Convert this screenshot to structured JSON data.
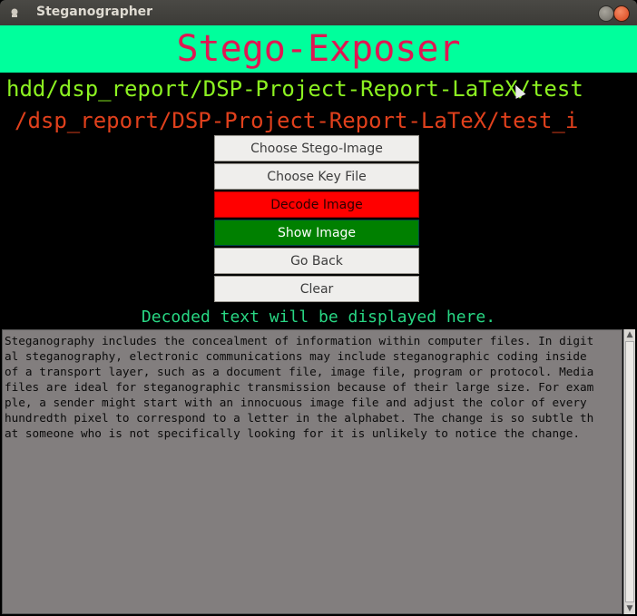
{
  "window": {
    "title": "Steganographer"
  },
  "header": {
    "title": "Stego-Exposer"
  },
  "paths": {
    "line1": "hdd/dsp_report/DSP-Project-Report-LaTeX/test",
    "line2": "/dsp_report/DSP-Project-Report-LaTeX/test_i"
  },
  "buttons": {
    "choose_stego": "Choose Stego-Image",
    "choose_key": "Choose Key File",
    "decode": "Decode Image",
    "show": "Show Image",
    "go_back": "Go Back",
    "clear": "Clear"
  },
  "status": "Decoded text will be displayed here.",
  "output_text": "Steganography includes the concealment of information within computer files. In digit\nal steganography, electronic communications may include steganographic coding inside\nof a transport layer, such as a document file, image file, program or protocol. Media\nfiles are ideal for steganographic transmission because of their large size. For exam\nple, a sender might start with an innocuous image file and adjust the color of every\nhundredth pixel to correspond to a letter in the alphabet. The change is so subtle th\nat someone who is not specifically looking for it is unlikely to notice the change.",
  "colors": {
    "header_bg": "#00ff9c",
    "header_text": "#e01652",
    "path1": "#8cf221",
    "path2": "#e0401c",
    "decode_bg": "#ff0000",
    "show_bg": "#008000",
    "status_text": "#28d683",
    "textarea_bg": "#827e7e"
  },
  "icons": {
    "app": "app-icon",
    "minimize": "minimize-icon",
    "close": "close-icon",
    "scroll_up": "scroll-up-icon",
    "scroll_down": "scroll-down-icon"
  }
}
